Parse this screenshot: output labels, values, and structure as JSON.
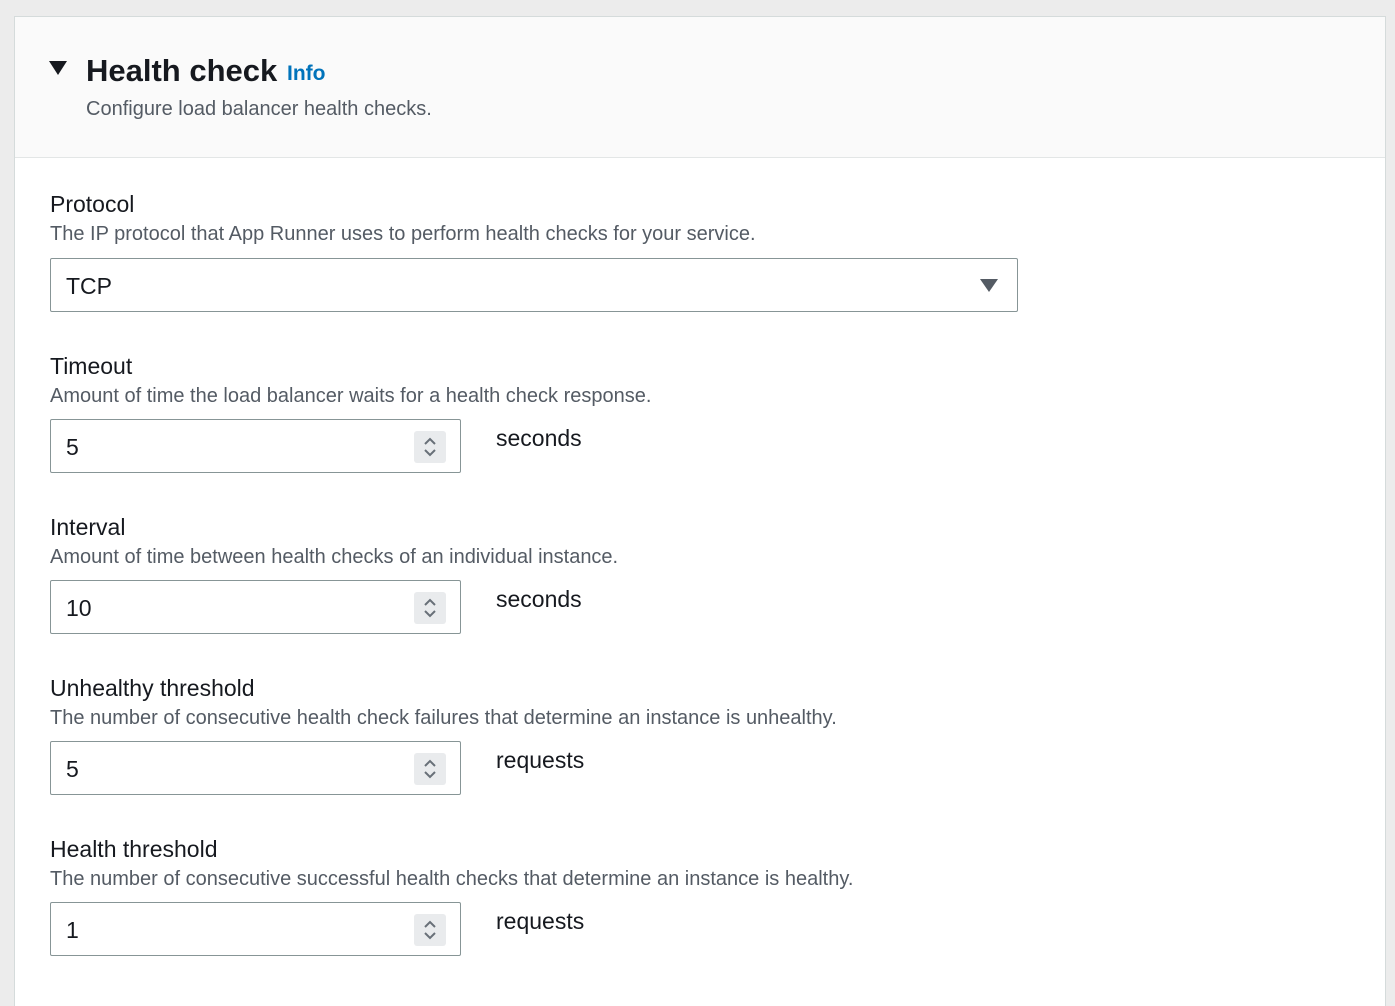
{
  "section": {
    "title": "Health check",
    "info_link": "Info",
    "description": "Configure load balancer health checks."
  },
  "protocol": {
    "label": "Protocol",
    "description": "The IP protocol that App Runner uses to perform health checks for your service.",
    "value": "TCP"
  },
  "timeout": {
    "label": "Timeout",
    "description": "Amount of time the load balancer waits for a health check response.",
    "value": "5",
    "unit": "seconds"
  },
  "interval": {
    "label": "Interval",
    "description": "Amount of time between health checks of an individual instance.",
    "value": "10",
    "unit": "seconds"
  },
  "unhealthy_threshold": {
    "label": "Unhealthy threshold",
    "description": "The number of consecutive health check failures that determine an instance is unhealthy.",
    "value": "5",
    "unit": "requests"
  },
  "health_threshold": {
    "label": "Health threshold",
    "description": "The number of consecutive successful health checks that determine an instance is healthy.",
    "value": "1",
    "unit": "requests"
  },
  "icons": {
    "collapse": "caret-down-icon",
    "dropdown": "chevron-down-icon",
    "stepper": "up-down-stepper-icon"
  },
  "colors": {
    "link": "#0073bb",
    "text": "#16191f",
    "secondary_text": "#545b64",
    "border": "#879596"
  }
}
